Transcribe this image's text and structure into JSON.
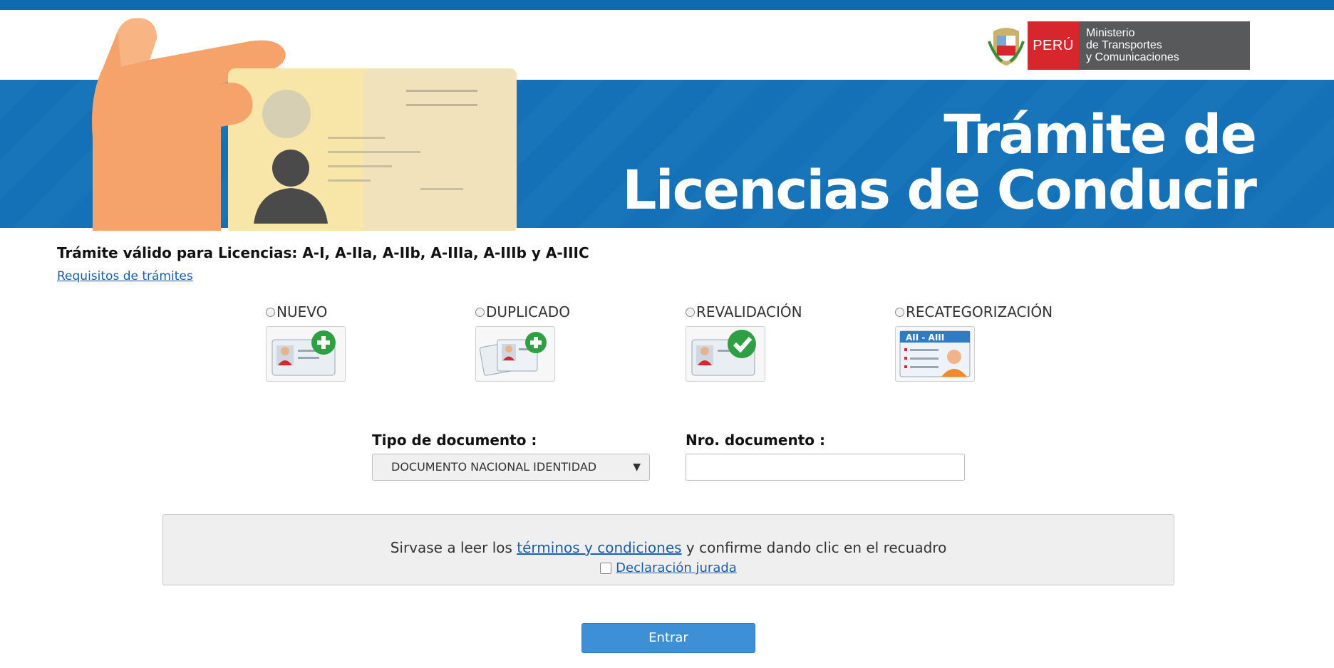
{
  "header": {
    "title_line1": "Trámite de",
    "title_line2": "Licencias de Conducir",
    "logo_country": "PERÚ",
    "logo_ministry_lines": [
      "Ministerio",
      "de Transportes",
      "y Comunicaciones"
    ],
    "brand_color": "#1471b7",
    "logo_red": "#d8262d",
    "logo_gray": "#58595b"
  },
  "main": {
    "valid_text": "Trámite válido para Licencias: A-I, A-IIa, A-IIb, A-IIIa, A-IIIb y A-IIIC",
    "requirements_link": "Requisitos de trámites",
    "options": [
      {
        "label": "NUEVO",
        "icon": "new-license-icon"
      },
      {
        "label": "DUPLICADO",
        "icon": "duplicate-license-icon"
      },
      {
        "label": "REVALIDACIÓN",
        "icon": "revalidation-license-icon"
      },
      {
        "label": "RECATEGORIZACIÓN",
        "icon": "recategorization-license-icon",
        "icon_text": "AII - AIII"
      }
    ],
    "doc_type_label": "Tipo de documento :",
    "doc_type_value": "DOCUMENTO NACIONAL IDENTIDAD",
    "doc_number_label": "Nro. documento :",
    "doc_number_value": ""
  },
  "terms": {
    "prefix": "Sirvase a leer los ",
    "link": "términos y condiciones",
    "suffix": " y confirme dando clic en el recuadro",
    "declaration": "Declaración jurada"
  },
  "actions": {
    "enter_label": "Entrar",
    "button_color": "#3d8fd6"
  }
}
